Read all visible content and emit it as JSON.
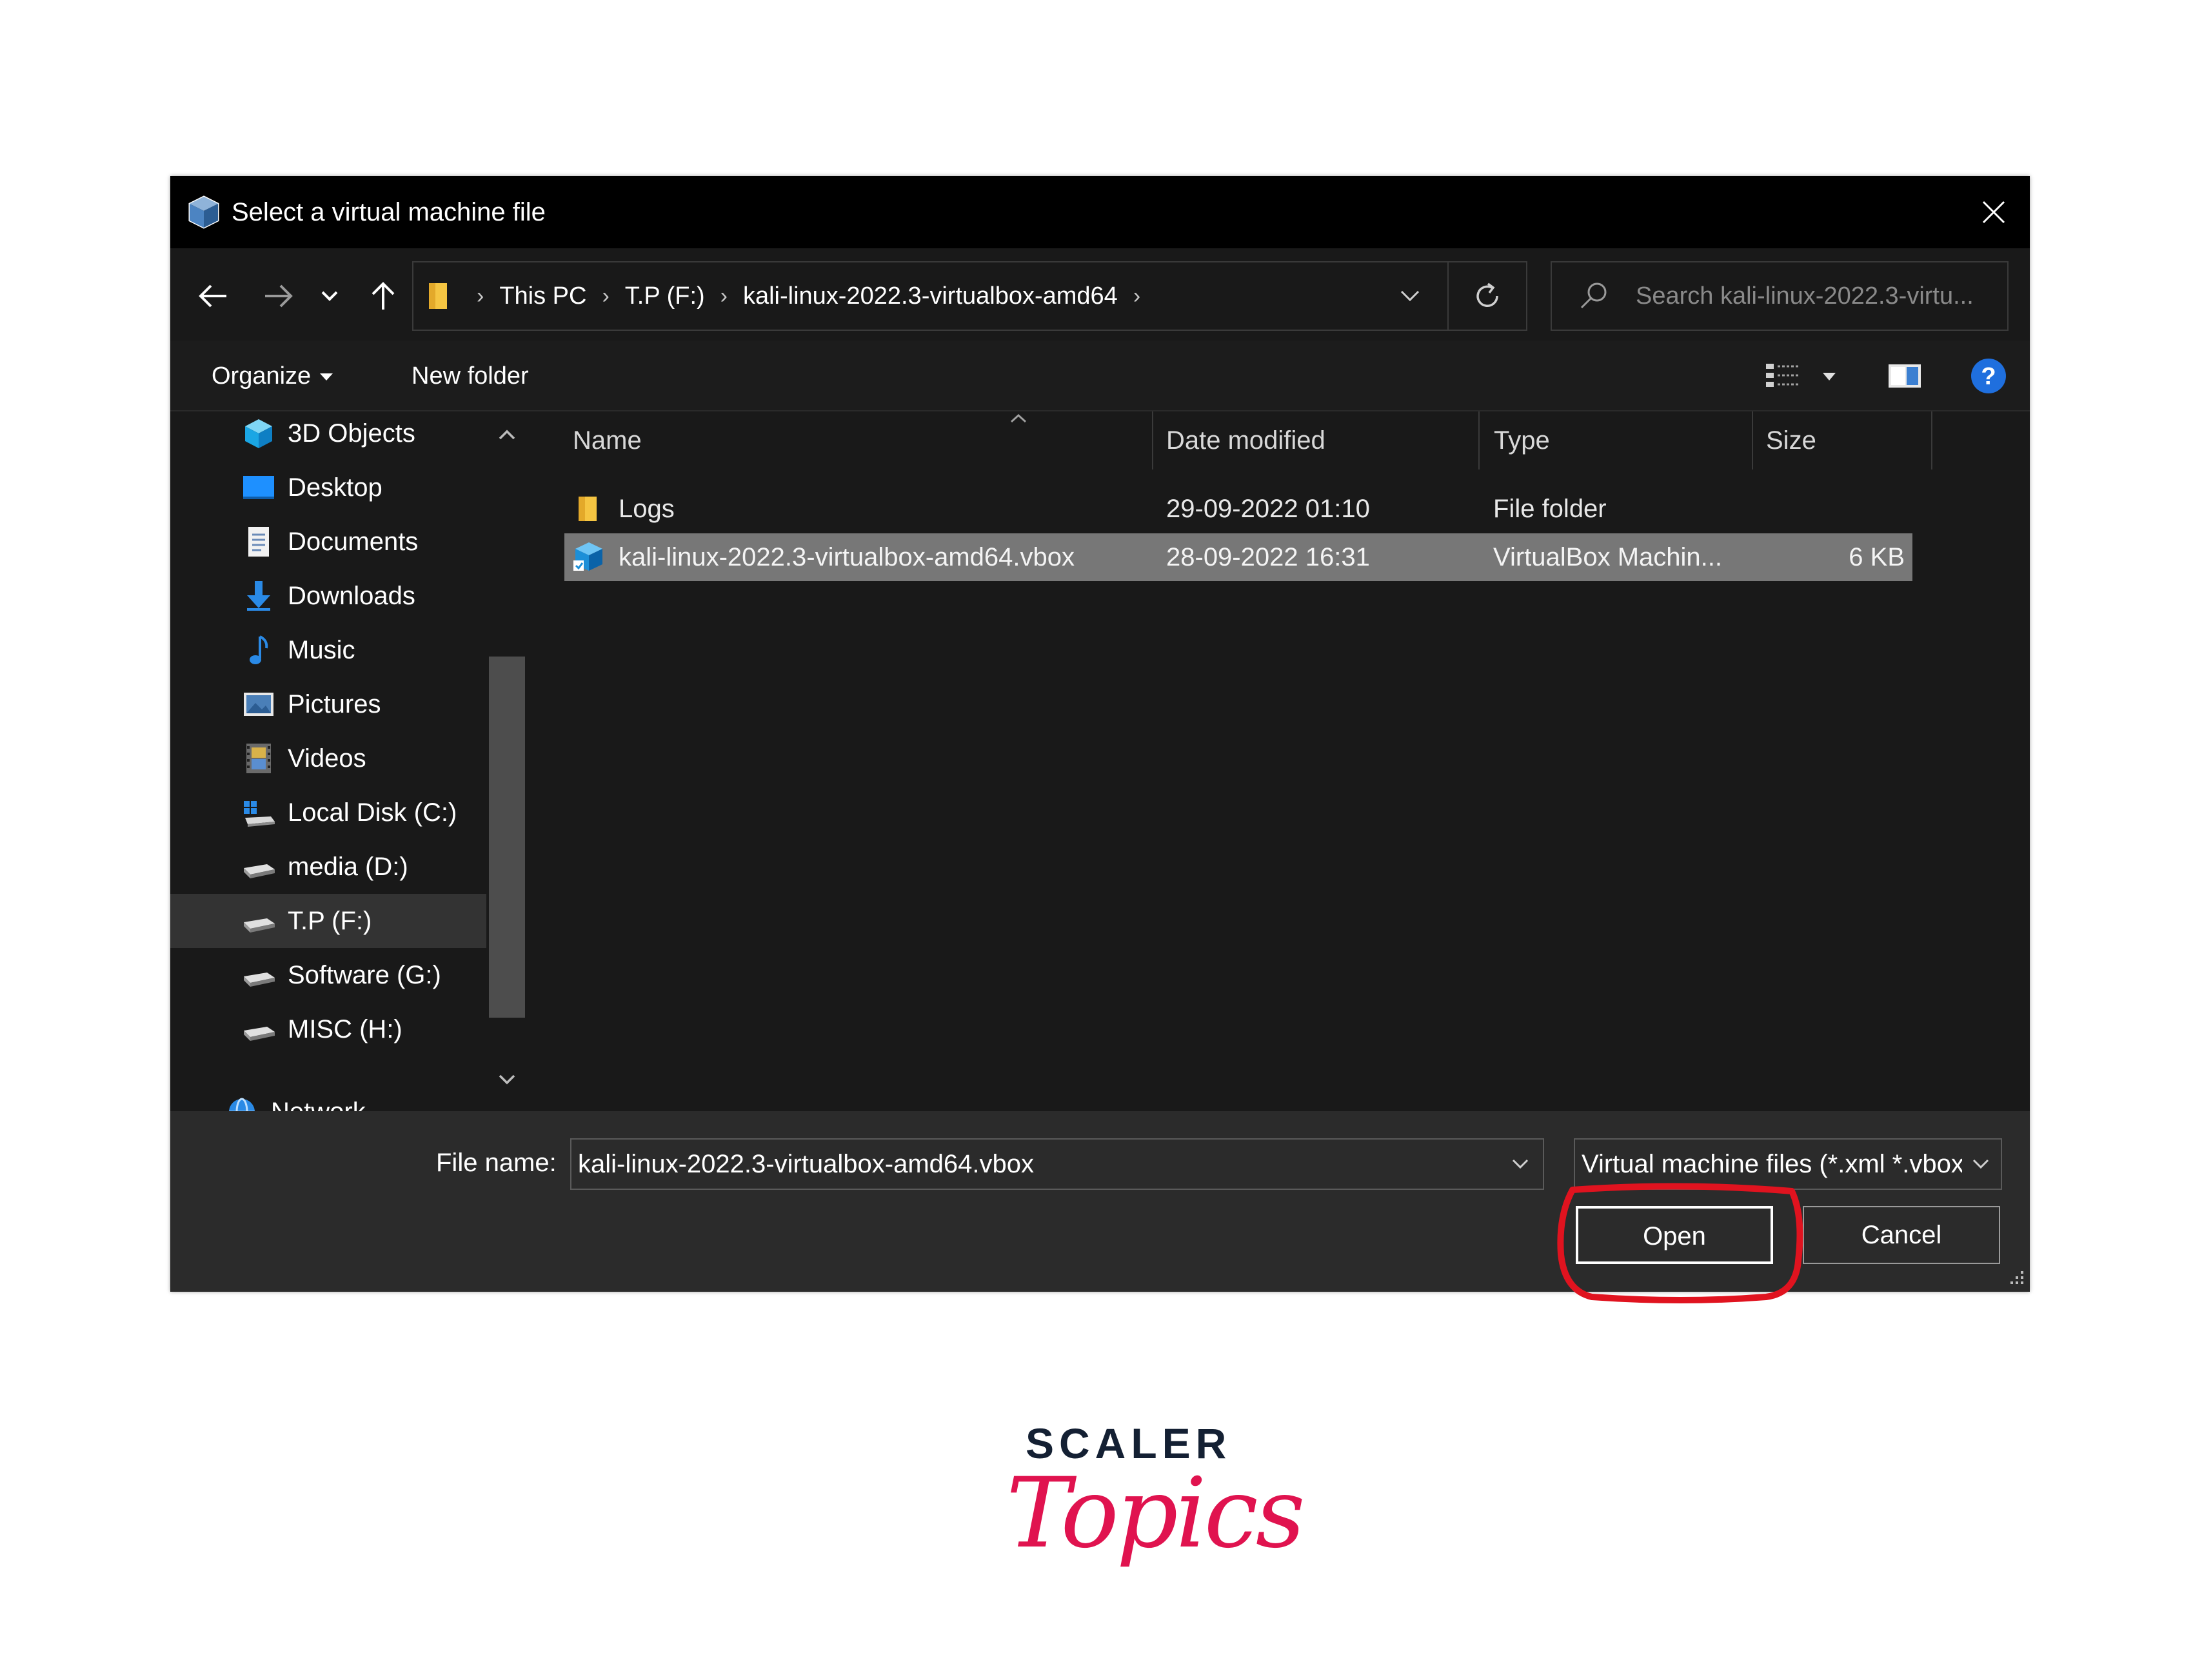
{
  "window": {
    "title": "Select a virtual machine file",
    "close_label": "✕"
  },
  "address": {
    "crumbs": [
      "This PC",
      "T.P (F:)",
      "kali-linux-2022.3-virtualbox-amd64"
    ]
  },
  "search": {
    "placeholder": "Search kali-linux-2022.3-virtu..."
  },
  "toolbar": {
    "organize": "Organize",
    "new_folder": "New folder"
  },
  "sidebar": {
    "items": [
      {
        "label": "3D Objects",
        "icon": "3d-objects-icon"
      },
      {
        "label": "Desktop",
        "icon": "desktop-icon"
      },
      {
        "label": "Documents",
        "icon": "documents-icon"
      },
      {
        "label": "Downloads",
        "icon": "downloads-icon"
      },
      {
        "label": "Music",
        "icon": "music-icon"
      },
      {
        "label": "Pictures",
        "icon": "pictures-icon"
      },
      {
        "label": "Videos",
        "icon": "videos-icon"
      },
      {
        "label": "Local Disk (C:)",
        "icon": "local-disk-icon"
      },
      {
        "label": "media (D:)",
        "icon": "drive-icon"
      },
      {
        "label": "T.P (F:)",
        "icon": "drive-icon",
        "selected": true
      },
      {
        "label": "Software (G:)",
        "icon": "drive-icon"
      },
      {
        "label": "MISC (H:)",
        "icon": "drive-icon"
      },
      {
        "label": "Network",
        "icon": "network-icon"
      }
    ]
  },
  "columns": {
    "name": "Name",
    "date": "Date modified",
    "type": "Type",
    "size": "Size"
  },
  "files": [
    {
      "name": "Logs",
      "date": "29-09-2022 01:10",
      "type": "File folder",
      "size": "",
      "icon": "folder-icon"
    },
    {
      "name": "kali-linux-2022.3-virtualbox-amd64.vbox",
      "date": "28-09-2022 16:31",
      "type": "VirtualBox Machin...",
      "size": "6 KB",
      "icon": "virtualbox-file-icon",
      "selected": true
    }
  ],
  "footer": {
    "file_name_label": "File name:",
    "file_name_value": "kali-linux-2022.3-virtualbox-amd64.vbox",
    "file_type_value": "Virtual machine files (*.xml *.vbox)",
    "open_label": "Open",
    "cancel_label": "Cancel"
  },
  "brand": {
    "top": "SCALER",
    "script": "Topics"
  },
  "colors": {
    "highlight_ring": "#e0131f",
    "brand_pink": "#e0134f",
    "brand_navy": "#142033"
  }
}
